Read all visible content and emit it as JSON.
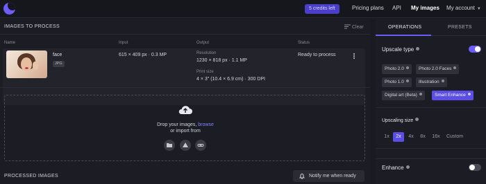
{
  "topbar": {
    "credits": "5 credits left",
    "nav": [
      "Pricing plans",
      "API",
      "My images",
      "My account"
    ]
  },
  "left": {
    "title": "IMAGES TO PROCESS",
    "clear": "Clear",
    "headers": [
      "Name",
      "Input",
      "Output",
      "Status"
    ],
    "item": {
      "name": "face",
      "format": "JPG",
      "input": "615 × 409 px · 0.3 MP",
      "resolution_label": "Resolution",
      "resolution": "1230 × 818 px · 1.1 MP",
      "print_label": "Print size",
      "print": "4 × 3\" (10.4 × 6.9 cm) · 300 DPI",
      "status": "Ready to process"
    },
    "drop": {
      "line1": "Drop your images,",
      "browse": "browse",
      "line2": "or import from"
    },
    "processed_title": "PROCESSED IMAGES",
    "notify": "Notify me when ready"
  },
  "right": {
    "tabs": [
      "OPERATIONS",
      "PRESETS"
    ],
    "upscale_type": "Upscale type",
    "upscale_type_on": true,
    "types": [
      "Photo 2.0",
      "Photo 2.0 Faces",
      "Photo 1.0",
      "Illustration",
      "Digital art (Beta)",
      "Smart Enhance"
    ],
    "selected_type": "Smart Enhance",
    "upscaling_size": "Upscaling size",
    "sizes": [
      "1x",
      "2x",
      "4x",
      "8x",
      "16x",
      "Custom"
    ],
    "selected_size": "2x",
    "enhance": "Enhance",
    "enhance_on": false
  },
  "colors": {
    "accent": "#6d5dfc",
    "background": "#1a1b22"
  }
}
